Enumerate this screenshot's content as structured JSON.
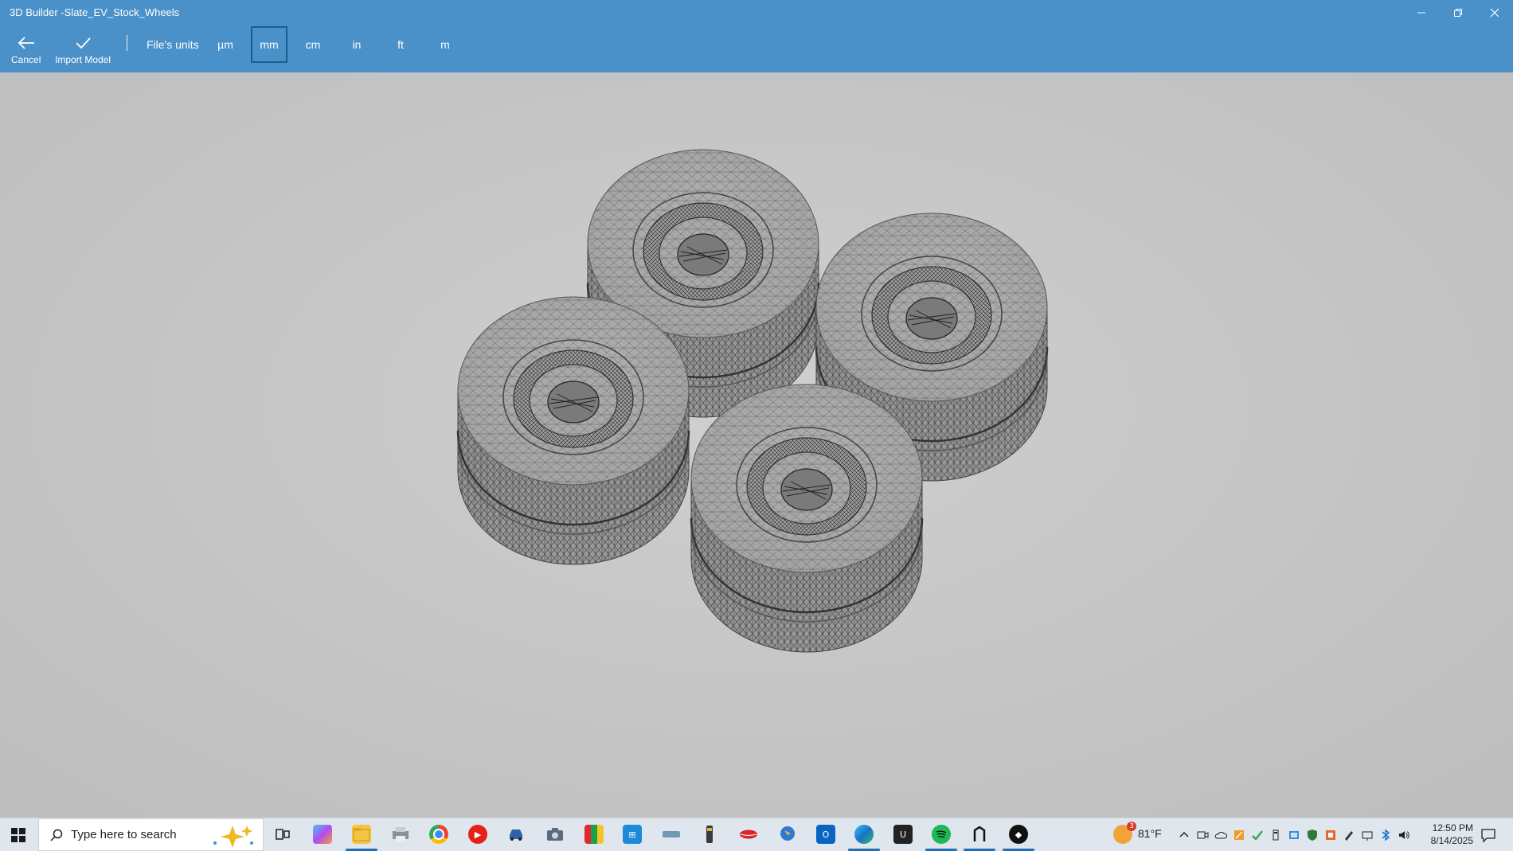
{
  "window": {
    "title": "3D Builder -Slate_EV_Stock_Wheels"
  },
  "toolbar": {
    "cancel_label": "Cancel",
    "import_label": "Import Model",
    "units_label": "File's units",
    "units": [
      {
        "label": "µm",
        "selected": false
      },
      {
        "label": "mm",
        "selected": true
      },
      {
        "label": "cm",
        "selected": false
      },
      {
        "label": "in",
        "selected": false
      },
      {
        "label": "ft",
        "selected": false
      },
      {
        "label": "m",
        "selected": false
      }
    ]
  },
  "viewport": {
    "model_name": "Slate_EV_Stock_Wheels",
    "wheel_count": 4
  },
  "taskbar": {
    "search_placeholder": "Type here to search",
    "weather_temp": "81°F",
    "weather_badge": "3",
    "time": "12:50 PM",
    "date": "8/14/2025"
  },
  "colors": {
    "titlebar": "#4a90c9",
    "selected_border": "#1d5d8e",
    "viewport_bg": "#c6c6c6",
    "taskbar_bg": "#dfe6ee"
  }
}
